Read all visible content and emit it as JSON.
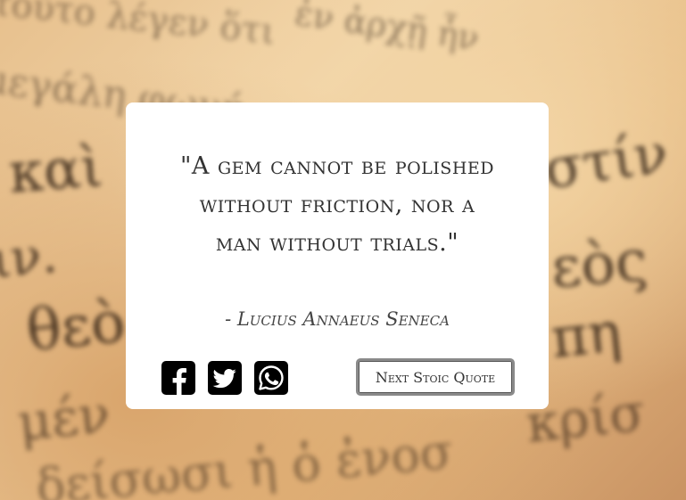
{
  "quote": {
    "text": "\"A gem cannot be polished without friction, nor a man without trials.\"",
    "author": "- Lucius Annaeus Seneca"
  },
  "social": {
    "facebook_icon": "facebook-icon",
    "twitter_icon": "twitter-icon",
    "whatsapp_icon": "whatsapp-icon"
  },
  "actions": {
    "next_label": "Next Stoic Quote"
  },
  "colors": {
    "card_background": "#ffffff",
    "text": "#333333",
    "icon_background": "#000000",
    "button_border": "#8a8a8a"
  }
}
